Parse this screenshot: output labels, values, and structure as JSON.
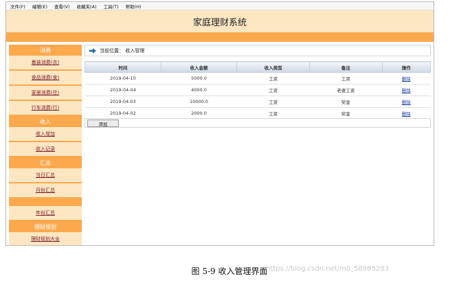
{
  "menubar": {
    "items": [
      {
        "label": "文件(F)"
      },
      {
        "label": "编辑(E)"
      },
      {
        "label": "查看(V)"
      },
      {
        "label": "收藏夹(A)"
      },
      {
        "label": "工具(T)"
      },
      {
        "label": "帮助(H)"
      }
    ]
  },
  "header": {
    "title": "家庭理财系统"
  },
  "sidebar": {
    "consumption": {
      "heading": "消费",
      "items": [
        {
          "label": "着装消费(衣)"
        },
        {
          "label": "食品消费(食)"
        },
        {
          "label": "家居消费(住)"
        },
        {
          "label": "行车消费(行)"
        }
      ]
    },
    "income": {
      "heading": "收入",
      "items": [
        {
          "label": "收入增加"
        },
        {
          "label": "收入记录"
        }
      ]
    },
    "summary": {
      "heading": "汇总",
      "items": [
        {
          "label": "当日汇总"
        },
        {
          "label": "月份汇总"
        },
        {
          "label": "年份汇总"
        }
      ]
    },
    "planning": {
      "heading": "理财规划",
      "items": [
        {
          "label": "理财规划大全"
        }
      ]
    }
  },
  "breadcrumb": {
    "text": "当前位置：  收入管理"
  },
  "table": {
    "headers": [
      "时间",
      "收入金额",
      "收入类型",
      "备注",
      "操作"
    ],
    "rows": [
      {
        "date": "2019-04-10",
        "amount": "5000.0",
        "type": "工资",
        "note": "工资",
        "action": "删除"
      },
      {
        "date": "2019-04-04",
        "amount": "4000.0",
        "type": "工资",
        "note": "老婆工资",
        "action": "删除"
      },
      {
        "date": "2019-04-03",
        "amount": "10000.0",
        "type": "工资",
        "note": "奖金",
        "action": "删除"
      },
      {
        "date": "2019-04-02",
        "amount": "2000.0",
        "type": "工资",
        "note": "奖金",
        "action": "删除"
      }
    ]
  },
  "add_button": {
    "label": "添加"
  },
  "caption": {
    "text": "图 5-9 收入管理界面"
  },
  "watermark": {
    "text": "https://blog.csdn.net/m0_58985283"
  },
  "colors": {
    "header_bg": "#fde6c2",
    "accent_orange": "#fca94e",
    "link_red": "#7a1f2a",
    "link_blue": "#1b3fa0"
  }
}
